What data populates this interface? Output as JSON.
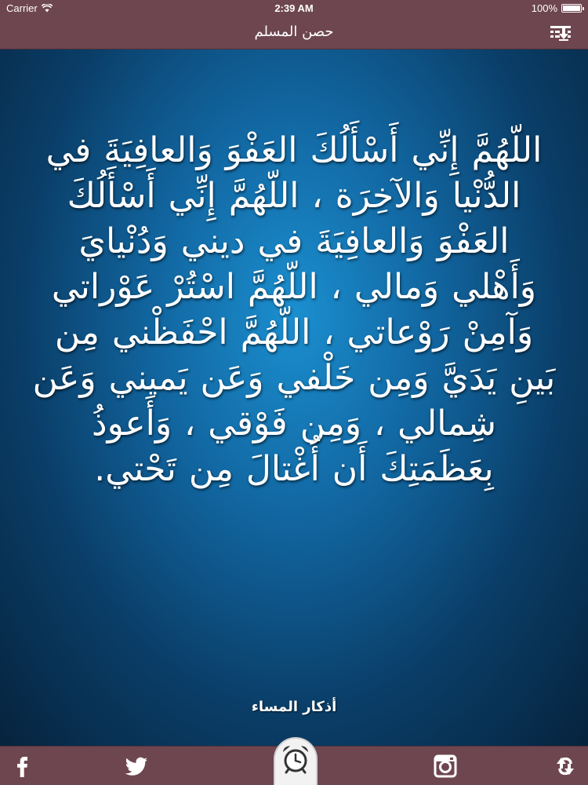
{
  "status_bar": {
    "carrier": "Carrier",
    "time": "2:39 AM",
    "battery": "100%",
    "battery_level": 1.0
  },
  "nav": {
    "title": "حصن المسلم",
    "menu_icon": "list-download-icon"
  },
  "content": {
    "dua": "اللّهُمَّ إِنِّي أَسْأَلُكَ العَفْوَ وَالعافِيَةَ في الدُّنْيا وَالآخِرَة ، اللّهُمَّ إِنِّي أَسْأَلُكَ العَفْوَ وَالعافِيَةَ في ديني وَدُنْيايَ وَأَهْلي وَمالي ، اللّهُمَّ اسْتُرْ عَوْراتي وَآمِنْ رَوْعاتي ، اللّهُمَّ احْفَظْني مِن بَينِ يَدَيَّ وَمِن خَلْفي وَعَن يَميني وَعَن شِمالي ، وَمِن فَوْقي ، وَأَعوذُ بِعَظَمَتِكَ أَن أُغْتالَ مِن تَحْتي.",
    "section_title": "أذكار المساء"
  },
  "tab_bar": {
    "icons": [
      "facebook-icon",
      "twitter-icon",
      "alarm-clock-icon",
      "instagram-icon",
      "share-arrows-icon"
    ]
  },
  "colors": {
    "bar": "#6e4650",
    "text": "#ffffff",
    "background_center": "#1b8fd0",
    "background_edge": "#06233d"
  }
}
